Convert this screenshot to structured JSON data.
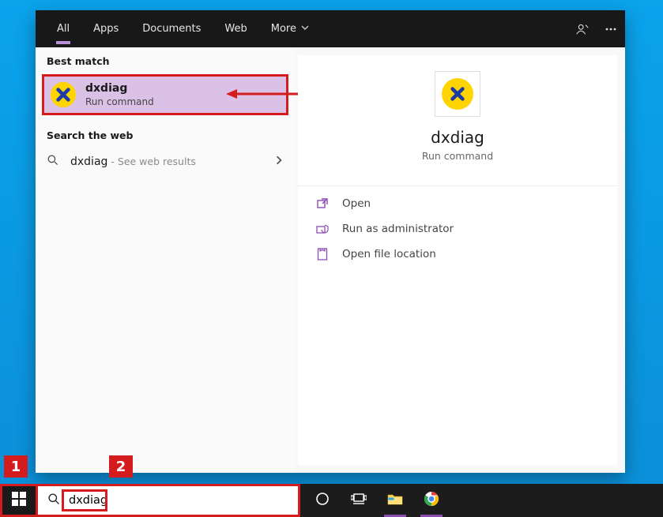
{
  "tabs": {
    "all": "All",
    "apps": "Apps",
    "documents": "Documents",
    "web": "Web",
    "more": "More"
  },
  "left": {
    "best_match_label": "Best match",
    "best_match": {
      "title": "dxdiag",
      "subtitle": "Run command"
    },
    "search_web_label": "Search the web",
    "web_result": {
      "term": "dxdiag",
      "hint": " - See web results"
    }
  },
  "detail": {
    "title": "dxdiag",
    "subtitle": "Run command",
    "actions": {
      "open": "Open",
      "admin": "Run as administrator",
      "location": "Open file location"
    }
  },
  "taskbar": {
    "search_value": "dxdiag"
  },
  "markers": {
    "one": "1",
    "two": "2"
  },
  "icons": {
    "dxdiag": "dxdiag-icon",
    "search": "search-icon",
    "chevron_right": "chevron-right-icon",
    "chevron_down": "chevron-down-icon",
    "open": "open-icon",
    "shield": "shield-icon",
    "folder": "folder-icon",
    "person": "person-icon",
    "more_h": "more-horizontal-icon",
    "cortana": "cortana-icon",
    "taskview": "taskview-icon",
    "explorer": "file-explorer-icon",
    "chrome": "chrome-icon",
    "start": "start-icon"
  },
  "colors": {
    "accent": "#8a4db0",
    "marker": "#d41b1d",
    "desktop": "#0aa3ec",
    "highlight": "#dcc1e6"
  }
}
